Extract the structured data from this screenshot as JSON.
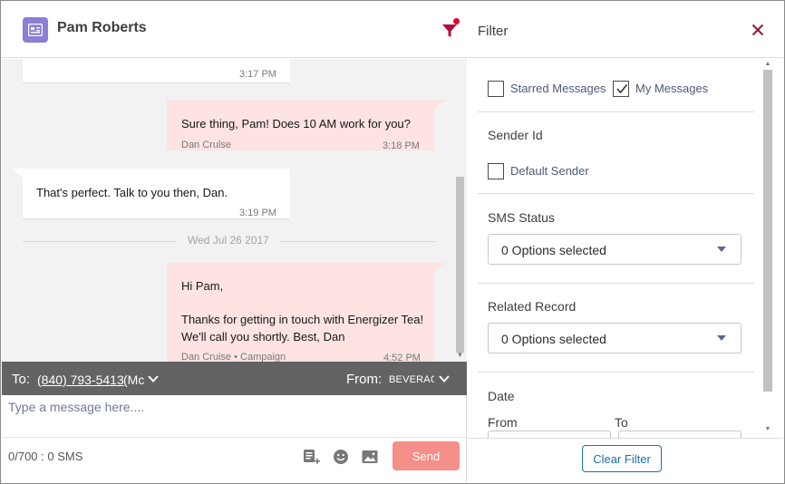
{
  "chat": {
    "contact_name": "Pam Roberts",
    "messages": [
      {
        "direction": "in",
        "text": "",
        "time": "3:17 PM"
      },
      {
        "direction": "out",
        "text": "Sure thing, Pam! Does 10 AM work for you?",
        "sender": "Dan Crulse",
        "time": "3:18 PM"
      },
      {
        "direction": "in",
        "text": "That's perfect. Talk to you then, Dan.",
        "time": "3:19 PM"
      },
      {
        "direction": "out",
        "text_line1": "Hi Pam,",
        "text_line2": "Thanks for getting in touch with Energizer Tea! We'll call you shortly. Best, Dan",
        "sender": "Dan Cruise",
        "campaign": "Campaign",
        "time": "4:52 PM"
      }
    ],
    "date_separator": "Wed Jul 26 2017",
    "recipient": {
      "to_label": "To:",
      "to_number": "(840) 793-5413",
      "to_suffix": "(Mc",
      "from_label": "From:",
      "from_value": "BEVERAG"
    },
    "compose": {
      "placeholder": "Type a message here....",
      "counter": "0/700 : 0 SMS",
      "send_label": "Send"
    },
    "colors": {
      "accent": "#1b6fae",
      "send": "#f48f89",
      "outgoing_bubble": "#fde3e1",
      "contact_icon": "#8b7fd6"
    }
  },
  "filter": {
    "title": "Filter",
    "starred_label": "Starred Messages",
    "starred_checked": false,
    "my_messages_label": "My Messages",
    "my_messages_checked": true,
    "sender_id_label": "Sender Id",
    "default_sender_label": "Default Sender",
    "default_sender_checked": false,
    "sms_status_label": "SMS Status",
    "sms_status_value": "0 Options selected",
    "related_record_label": "Related Record",
    "related_record_value": "0 Options selected",
    "date_label": "Date",
    "from_label": "From",
    "to_label": "To",
    "clear_label": "Clear Filter"
  }
}
